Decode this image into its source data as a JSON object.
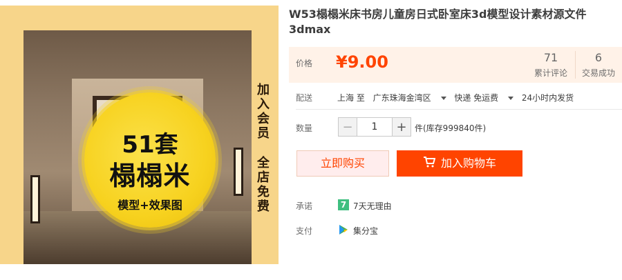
{
  "product": {
    "title": "W53榻榻米床书房儿童房日式卧室床3d模型设计素材源文件3dmax",
    "image": {
      "badge_count": "51套",
      "badge_title": "榻榻米",
      "badge_subtitle": "模型+效果图",
      "promo_vertical_1": [
        "加",
        "入",
        "会",
        "员"
      ],
      "promo_vertical_2": [
        "全",
        "店",
        "免",
        "费"
      ]
    }
  },
  "price": {
    "label": "价格",
    "value": "¥9.00",
    "color": "#ff4400",
    "reviews_count": "71",
    "reviews_label": "累计评论",
    "sold_count": "6",
    "sold_label": "交易成功"
  },
  "shipping": {
    "label": "配送",
    "from": "上海 至",
    "destination": "广东珠海金湾区",
    "method": "快递 免运费",
    "dispatch": "24小时内发货"
  },
  "quantity": {
    "label": "数量",
    "value": "1",
    "stock": "件(库存999840件)"
  },
  "actions": {
    "buy_now": "立即购买",
    "add_to_cart": "加入购物车"
  },
  "promise": {
    "label": "承诺",
    "icon_glyph": "7",
    "text": "7天无理由"
  },
  "payment": {
    "label": "支付",
    "text": "集分宝"
  }
}
